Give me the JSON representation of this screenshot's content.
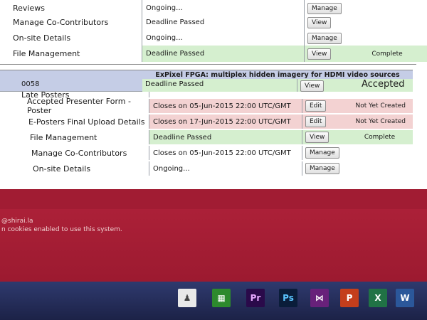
{
  "top_section": {
    "rows": [
      {
        "label": "Reviews",
        "status": "Ongoing...",
        "action": "Manage",
        "extra": "",
        "highlight": ""
      },
      {
        "label": "Manage Co-Contributors",
        "status": "Deadline Passed",
        "action": "View",
        "extra": "",
        "highlight": ""
      },
      {
        "label": "On-site Details",
        "status": "Ongoing...",
        "action": "Manage",
        "extra": "",
        "highlight": ""
      },
      {
        "label": "File Management",
        "status": "Deadline Passed",
        "action": "View",
        "extra": "Complete",
        "highlight": "green"
      }
    ]
  },
  "submission": {
    "id": "0058",
    "title": "ExPixel FPGA: multiplex hidden imagery for HDMI video sources",
    "overall_status": "Accepted",
    "rows": [
      {
        "label": "Late Posters",
        "status": "Deadline Passed",
        "action": "View",
        "extra": "",
        "highlight": "green"
      },
      {
        "label": "Accepted Presenter Form - Poster",
        "status": "Closes on 05-Jun-2015 22:00 UTC/GMT",
        "action": "Edit",
        "extra": "Not Yet Created",
        "highlight": "pink"
      },
      {
        "label": "E-Posters Final Upload Details",
        "status": "Closes on 17-Jun-2015 22:00 UTC/GMT",
        "action": "Edit",
        "extra": "Not Yet Created",
        "highlight": "pink"
      },
      {
        "label": "File Management",
        "status": "Deadline Passed",
        "action": "View",
        "extra": "Complete",
        "highlight": "green"
      },
      {
        "label": "Manage Co-Contributors",
        "status": "Closes on 05-Jun-2015 22:00 UTC/GMT",
        "action": "Manage",
        "extra": "",
        "highlight": ""
      },
      {
        "label": "On-site Details",
        "status": "Ongoing...",
        "action": "Manage",
        "extra": "",
        "highlight": ""
      }
    ]
  },
  "footer_error": {
    "line1": "@shirai.la",
    "line2": "n cookies enabled to use this system."
  },
  "taskbar": {
    "icons": [
      {
        "name": "cortana-icon",
        "label": "",
        "color": "#e9e9e9"
      },
      {
        "name": "store-icon",
        "label": "",
        "color": "#2d8a2d"
      },
      {
        "name": "premiere-icon",
        "label": "Pr",
        "color": "#2a0a4a"
      },
      {
        "name": "photoshop-icon",
        "label": "Ps",
        "color": "#0a1d3a"
      },
      {
        "name": "visual-studio-icon",
        "label": "",
        "color": "#68217a"
      },
      {
        "name": "powerpoint-icon",
        "label": "P",
        "color": "#c43e1c"
      },
      {
        "name": "excel-icon",
        "label": "X",
        "color": "#207245"
      },
      {
        "name": "word-icon",
        "label": "W",
        "color": "#2b579a"
      }
    ]
  }
}
